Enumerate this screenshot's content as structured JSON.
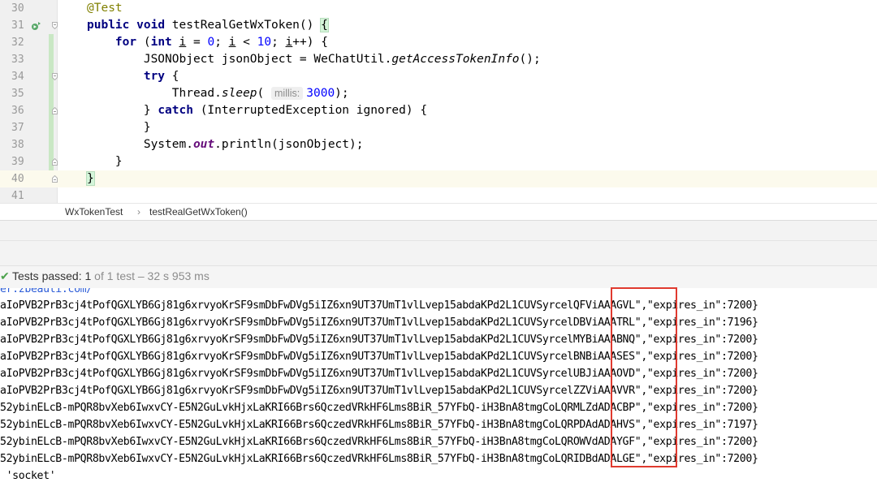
{
  "editor": {
    "lines": [
      {
        "num": "30"
      },
      {
        "num": "31"
      },
      {
        "num": "32"
      },
      {
        "num": "33"
      },
      {
        "num": "34"
      },
      {
        "num": "35"
      },
      {
        "num": "36"
      },
      {
        "num": "37"
      },
      {
        "num": "38"
      },
      {
        "num": "39"
      },
      {
        "num": "40"
      },
      {
        "num": "41"
      }
    ],
    "code": {
      "l30": "@Test",
      "l31_kw1": "public",
      "l31_kw2": "void",
      "l31_rest": " testRealGetWxToken() ",
      "l31_brace": "{",
      "l32_kw1": "for",
      "l32_p1": " (",
      "l32_kw2": "int",
      "l32_sp": " ",
      "l32_i1": "i",
      "l32_eq": " = ",
      "l32_n0": "0",
      "l32_semi1": "; ",
      "l32_i2": "i",
      "l32_lt": " < ",
      "l32_n10": "10",
      "l32_semi2": "; ",
      "l32_i3": "i",
      "l32_end": "++) {",
      "l33_a": "JSONObject jsonObject = WeChatUtil.",
      "l33_m": "getAccessTokenInfo",
      "l33_b": "();",
      "l34_kw": "try",
      "l34_b": " {",
      "l35_a": "Thread.",
      "l35_m": "sleep",
      "l35_p": "( ",
      "l35_hint": "millis:",
      "l35_n": "3000",
      "l35_end": ");",
      "l36_a": "} ",
      "l36_kw": "catch",
      "l36_b": " (InterruptedException ignored) {",
      "l37": "}",
      "l38_a": "System.",
      "l38_f": "out",
      "l38_b": ".println(jsonObject);",
      "l39": "}",
      "l40": "}"
    }
  },
  "breadcrumb": {
    "class_name": "WxTokenTest",
    "separator": "›",
    "method_name": "testRealGetWxToken()"
  },
  "test_status": {
    "icon": "check-icon",
    "passed_label": "Tests passed: ",
    "count": "1",
    "of_text": " of 1 test – 32 s 953 ms"
  },
  "console": {
    "top_partial": "er.zbeauti.com/",
    "lines": [
      {
        "prefix": "aIoPVB2PrB3cj4tPofQGXLYB6Gj81g6xrvyoKrSF9smDbFwDVg5iIZ6xn9UT37UmT1vlLvep15abdaKPd2L1CUVSyrcel",
        "token": "QFViAAAGVL",
        "suffix": "\",\"expires_in\":7200}"
      },
      {
        "prefix": "aIoPVB2PrB3cj4tPofQGXLYB6Gj81g6xrvyoKrSF9smDbFwDVg5iIZ6xn9UT37UmT1vlLvep15abdaKPd2L1CUVSyrcel",
        "token": "DBViAAATRL",
        "suffix": "\",\"expires_in\":7196}"
      },
      {
        "prefix": "aIoPVB2PrB3cj4tPofQGXLYB6Gj81g6xrvyoKrSF9smDbFwDVg5iIZ6xn9UT37UmT1vlLvep15abdaKPd2L1CUVSyrcel",
        "token": "MYBiAAABNQ",
        "suffix": "\",\"expires_in\":7200}"
      },
      {
        "prefix": "aIoPVB2PrB3cj4tPofQGXLYB6Gj81g6xrvyoKrSF9smDbFwDVg5iIZ6xn9UT37UmT1vlLvep15abdaKPd2L1CUVSyrcel",
        "token": "BNBiAAASES",
        "suffix": "\",\"expires_in\":7200}"
      },
      {
        "prefix": "aIoPVB2PrB3cj4tPofQGXLYB6Gj81g6xrvyoKrSF9smDbFwDVg5iIZ6xn9UT37UmT1vlLvep15abdaKPd2L1CUVSyrcel",
        "token": "UBJiAAAOVD",
        "suffix": "\",\"expires_in\":7200}"
      },
      {
        "prefix": "aIoPVB2PrB3cj4tPofQGXLYB6Gj81g6xrvyoKrSF9smDbFwDVg5iIZ6xn9UT37UmT1vlLvep15abdaKPd2L1CUVSyrcel",
        "token": "ZZViAAAVVR",
        "suffix": "\",\"expires_in\":7200}"
      },
      {
        "prefix": "52ybinELcB-mPQR8bvXeb6IwxvCY-E5N2GuLvkHjxLaKRI66Brs6QczedVRkHF6Lms8BiR_57YFbQ-iH3BnA8tmgCoLQR",
        "token": "MLZdADACBP",
        "suffix": "\",\"expires_in\":7200}"
      },
      {
        "prefix": "52ybinELcB-mPQR8bvXeb6IwxvCY-E5N2GuLvkHjxLaKRI66Brs6QczedVRkHF6Lms8BiR_57YFbQ-iH3BnA8tmgCoLQR",
        "token": "PDAdADAHVS",
        "suffix": "\",\"expires_in\":7197}"
      },
      {
        "prefix": "52ybinELcB-mPQR8bvXeb6IwxvCY-E5N2GuLvkHjxLaKRI66Brs6QczedVRkHF6Lms8BiR_57YFbQ-iH3BnA8tmgCoLQR",
        "token": "OWVdADAYGF",
        "suffix": "\",\"expires_in\":7200}"
      },
      {
        "prefix": "52ybinELcB-mPQR8bvXeb6IwxvCY-E5N2GuLvkHjxLaKRI66Brs6QczedVRkHF6Lms8BiR_57YFbQ-iH3BnA8tmgCoLQR",
        "token": "IDBdADALGE",
        "suffix": "\",\"expires_in\":7200}"
      }
    ],
    "bottom_line": " 'socket'"
  },
  "colors": {
    "highlight_box": "#e03a2f",
    "pass_check": "#4ca24c",
    "keyword": "#000080",
    "annotation": "#808000",
    "number": "#0000ff"
  }
}
